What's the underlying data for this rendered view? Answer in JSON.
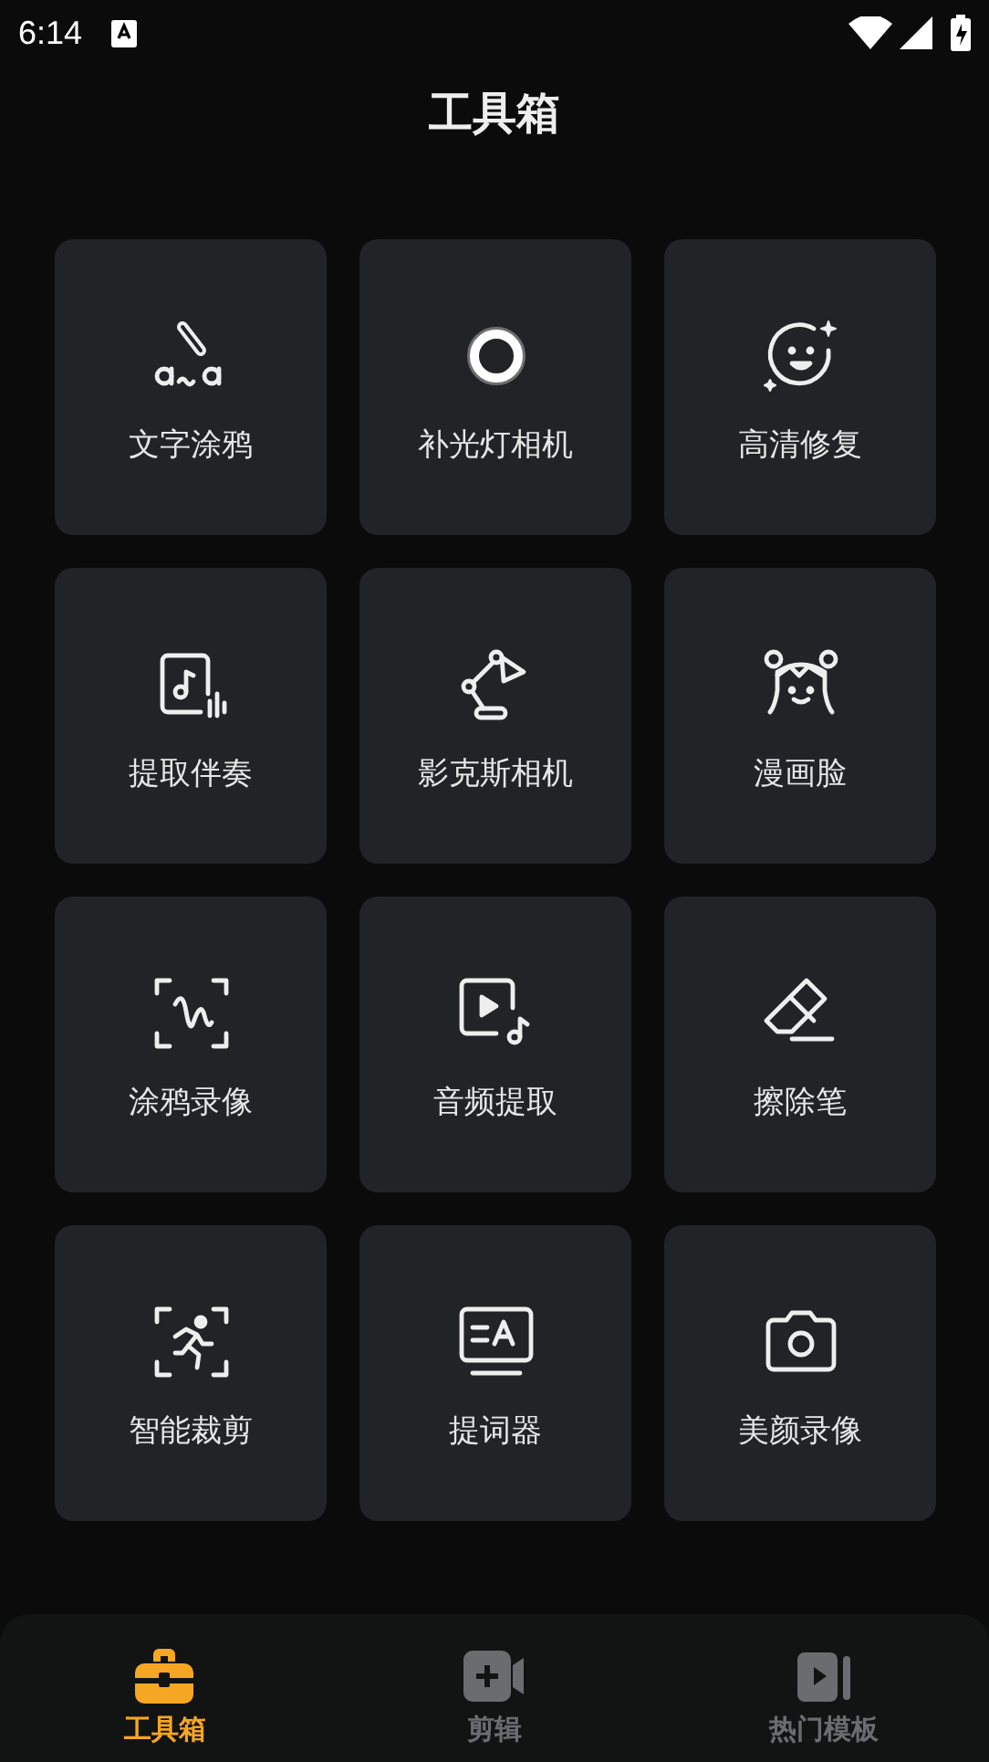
{
  "status_bar": {
    "time": "6:14"
  },
  "title": "工具箱",
  "tools": [
    {
      "label": "文字涂鸦",
      "kind": "text-doodle"
    },
    {
      "label": "补光灯相机",
      "kind": "ring-light"
    },
    {
      "label": "高清修复",
      "kind": "sparkle-face"
    },
    {
      "label": "提取伴奏",
      "kind": "music-extract"
    },
    {
      "label": "影克斯相机",
      "kind": "lamp"
    },
    {
      "label": "漫画脸",
      "kind": "comic-face"
    },
    {
      "label": "涂鸦录像",
      "kind": "scribble"
    },
    {
      "label": "音频提取",
      "kind": "video-music"
    },
    {
      "label": "擦除笔",
      "kind": "eraser"
    },
    {
      "label": "智能裁剪",
      "kind": "runner"
    },
    {
      "label": "提词器",
      "kind": "teleprompter"
    },
    {
      "label": "美颜录像",
      "kind": "camera"
    }
  ],
  "nav": [
    {
      "label": "工具箱",
      "kind": "toolbox",
      "selected": true
    },
    {
      "label": "剪辑",
      "kind": "video-add",
      "selected": false
    },
    {
      "label": "热门模板",
      "kind": "templates",
      "selected": false
    }
  ]
}
